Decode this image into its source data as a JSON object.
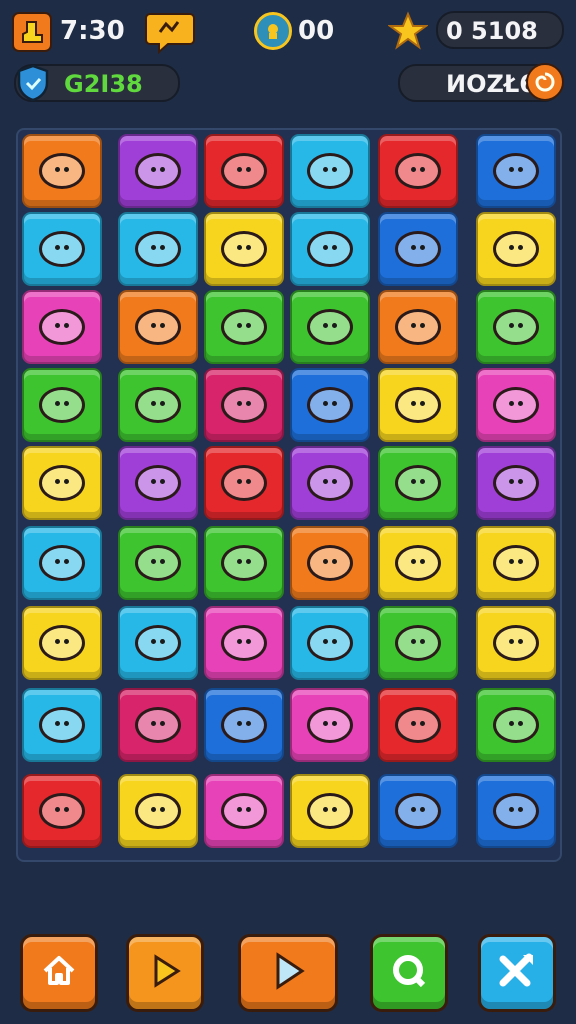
{
  "hud": {
    "time": "7:30",
    "coins": "00",
    "star_score": "0 5108",
    "level_code": "G2I38",
    "mode_label": "ИOZŁ6"
  },
  "icons": {
    "hud_left": "boot-icon",
    "hud_chat": "chat-bubble-icon",
    "hud_coin": "coin-icon",
    "hud_star": "star-icon",
    "hud_shield": "shield-icon",
    "hud_badge": "swirl-badge-icon"
  },
  "tile_colors": {
    "orange": "#f07a1c",
    "purple": "#a03fd8",
    "red": "#e4282c",
    "cyan": "#27b8e8",
    "blue": "#1e6fd9",
    "yellow": "#f7d51e",
    "pink": "#e842b8",
    "green": "#3dc42f",
    "magenta": "#d8246a"
  },
  "board": [
    [
      {
        "c": "orange",
        "i": "pot-icon"
      },
      {
        "c": "purple",
        "i": "cake-icon"
      },
      {
        "c": "red",
        "i": "pot-icon"
      },
      {
        "c": "cyan",
        "i": "fish-creature-icon"
      },
      {
        "c": "red",
        "i": "frog-face-icon"
      },
      {
        "c": "blue",
        "i": "duck-icon"
      }
    ],
    [
      {
        "c": "cyan",
        "i": "whale-icon"
      },
      {
        "c": "cyan",
        "i": "fish-icon"
      },
      {
        "c": "yellow",
        "i": "planet-icon"
      },
      {
        "c": "cyan",
        "i": "heart-icon"
      },
      {
        "c": "blue",
        "i": "star-creature-icon"
      },
      {
        "c": "yellow",
        "i": "heart-icon"
      }
    ],
    [
      {
        "c": "pink",
        "i": "house-icon"
      },
      {
        "c": "orange",
        "i": "sun-creature-icon"
      },
      {
        "c": "green",
        "i": "cat-face-icon"
      },
      {
        "c": "green",
        "i": "creature-icon"
      },
      {
        "c": "orange",
        "i": "pig-face-icon"
      },
      {
        "c": "green",
        "i": "planet-icon"
      }
    ],
    [
      {
        "c": "green",
        "i": "fish-hat-icon"
      },
      {
        "c": "green",
        "i": "heart-icon"
      },
      {
        "c": "magenta",
        "i": "bear-face-icon"
      },
      {
        "c": "blue",
        "i": "snail-icon"
      },
      {
        "c": "yellow",
        "i": "cat-face-icon"
      },
      {
        "c": "pink",
        "i": "planet-icon"
      }
    ],
    [
      {
        "c": "yellow",
        "i": "creature-icon"
      },
      {
        "c": "purple",
        "i": "ball-icon"
      },
      {
        "c": "red",
        "i": "gear-icon"
      },
      {
        "c": "purple",
        "i": "planet-icon"
      },
      {
        "c": "green",
        "i": "sun-creature-icon"
      },
      {
        "c": "purple",
        "i": "smiley-icon"
      }
    ],
    [
      {
        "c": "cyan",
        "i": "orb-icon"
      },
      {
        "c": "green",
        "i": "creature-icon"
      },
      {
        "c": "green",
        "i": "blob-icon"
      },
      {
        "c": "orange",
        "i": "creature-icon"
      },
      {
        "c": "yellow",
        "i": "heart-icon"
      },
      {
        "c": "yellow",
        "i": "creature-icon"
      }
    ],
    [
      {
        "c": "yellow",
        "i": "flame-icon"
      },
      {
        "c": "cyan",
        "i": "sun-creature-icon"
      },
      {
        "c": "pink",
        "i": "sun-creature-icon"
      },
      {
        "c": "cyan",
        "i": "sun-creature-icon"
      },
      {
        "c": "green",
        "i": "planet-icon"
      },
      {
        "c": "yellow",
        "i": "creature-icon"
      }
    ],
    [
      {
        "c": "cyan",
        "i": "leaf-icon"
      },
      {
        "c": "magenta",
        "i": "bird-icon"
      },
      {
        "c": "blue",
        "i": "planet-icon"
      },
      {
        "c": "pink",
        "i": "bear-face-icon"
      },
      {
        "c": "red",
        "i": "frog-face-icon"
      },
      {
        "c": "green",
        "i": "heart-icon"
      }
    ],
    [
      {
        "c": "red",
        "i": "spiky-creature-icon"
      },
      {
        "c": "yellow",
        "i": "sun-creature-icon"
      },
      {
        "c": "pink",
        "i": "bear-face-icon"
      },
      {
        "c": "yellow",
        "i": "blob-icon"
      },
      {
        "c": "blue",
        "i": "heart-icon"
      },
      {
        "c": "blue",
        "i": "paper-plane-icon"
      }
    ]
  ],
  "bottom_buttons": [
    {
      "name": "home-button",
      "icon": "home-icon",
      "color": "#f07a1c"
    },
    {
      "name": "play-button",
      "icon": "play-icon",
      "color": "#f5951e"
    },
    {
      "name": "next-button",
      "icon": "play-large-icon",
      "color": "#f07a1c"
    },
    {
      "name": "search-button",
      "icon": "search-icon",
      "color": "#3dc42f"
    },
    {
      "name": "shuffle-button",
      "icon": "shuffle-icon",
      "color": "#27b0e8"
    }
  ]
}
